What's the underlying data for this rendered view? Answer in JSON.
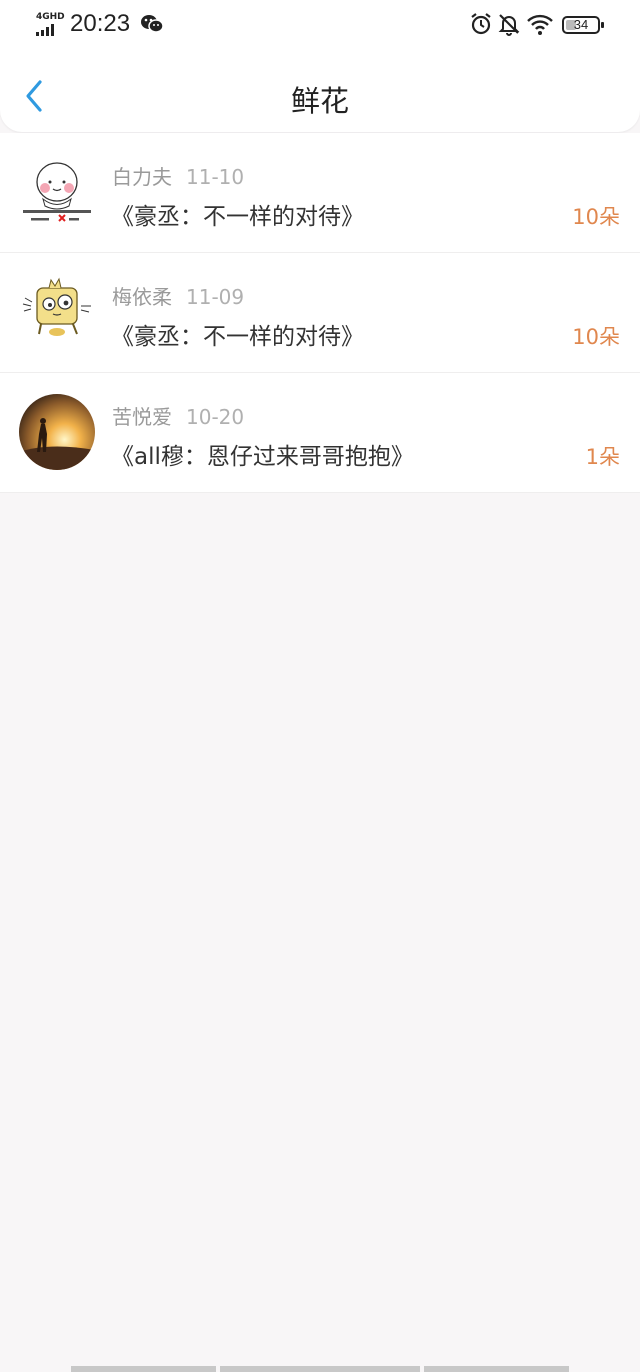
{
  "status": {
    "network": "4GHD",
    "time": "20:23",
    "battery": "34"
  },
  "nav": {
    "title": "鲜花"
  },
  "rows": [
    {
      "user": "白力夫",
      "date": "11-10",
      "book": "《豪丞：不一样的对待》",
      "count": "10朵",
      "avatar": "sticker-avatar"
    },
    {
      "user": "梅依柔",
      "date": "11-09",
      "book": "《豪丞：不一样的对待》",
      "count": "10朵",
      "avatar": "cartoon-avatar"
    },
    {
      "user": "苦悦爱",
      "date": "10-20",
      "book": "《all穆：恩仔过来哥哥抱抱》",
      "count": "1朵",
      "avatar": "sunset-avatar"
    }
  ],
  "colors": {
    "accent": "#2f9ae0",
    "count": "#e0874e",
    "background": "#f8f6f7"
  }
}
